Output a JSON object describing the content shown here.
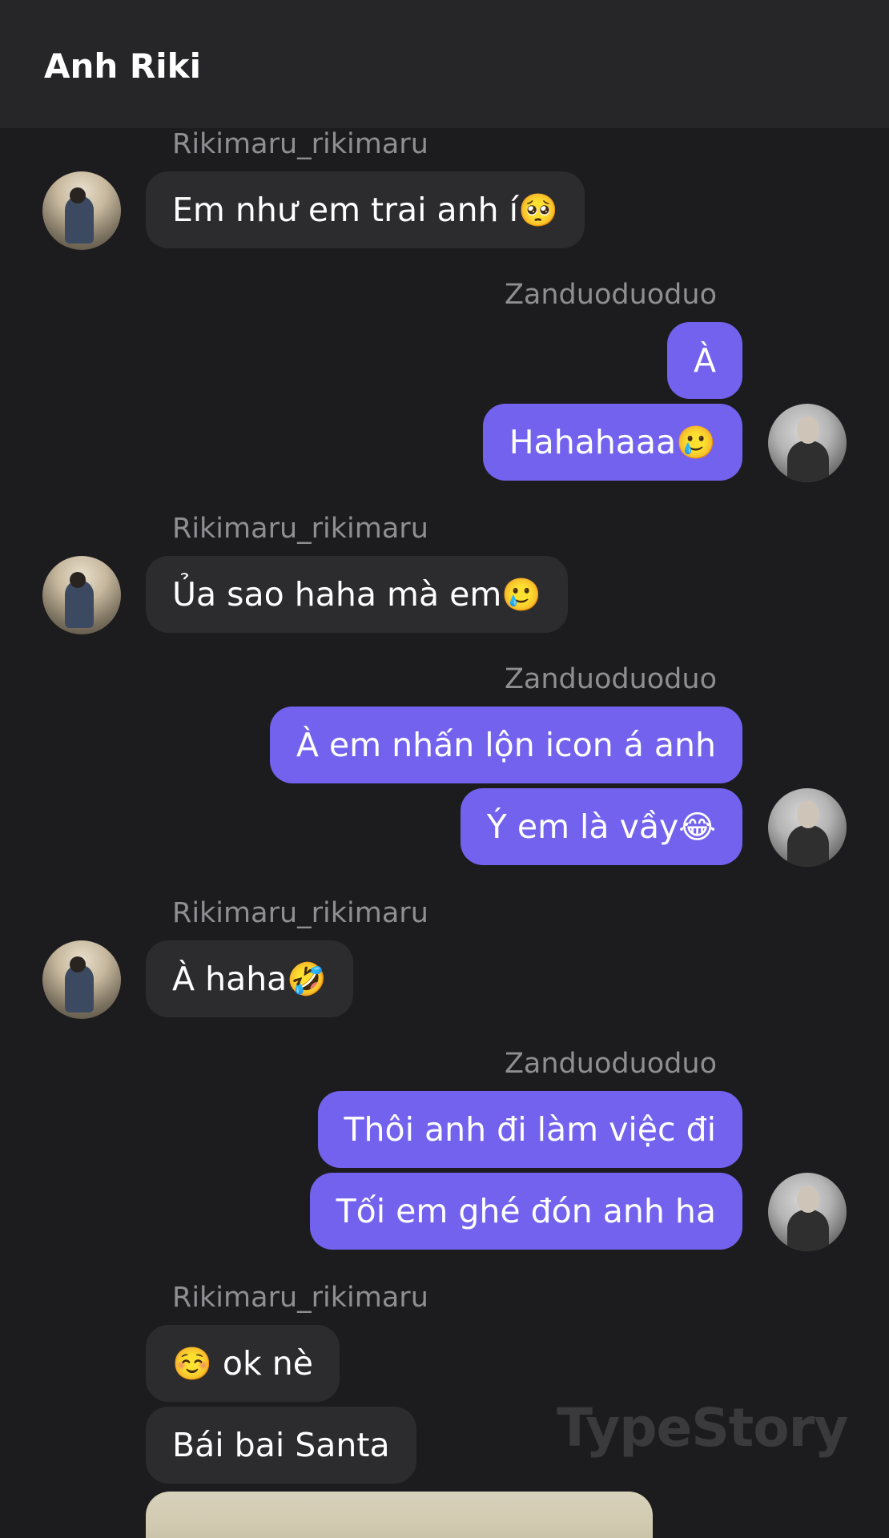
{
  "header": {
    "title": "Anh Riki"
  },
  "messages": [
    {
      "sender": "Rikimaru_rikimaru",
      "side": "in",
      "text": "Em như em trai anh í",
      "emoji": "🥺"
    },
    {
      "sender": "Zanduoduoduo",
      "side": "out",
      "text": "À"
    },
    {
      "side": "out",
      "text": "Hahahaaa",
      "emoji": "🥲"
    },
    {
      "sender": "Rikimaru_rikimaru",
      "side": "in",
      "text": "Ủa sao haha mà em",
      "emoji": "🥲"
    },
    {
      "sender": "Zanduoduoduo",
      "side": "out",
      "text": "À em nhấn lộn icon á anh"
    },
    {
      "side": "out",
      "text": "Ý em là vầy",
      "emoji": "😂"
    },
    {
      "sender": "Rikimaru_rikimaru",
      "side": "in",
      "text": "À haha",
      "emoji": "🤣"
    },
    {
      "sender": "Zanduoduoduo",
      "side": "out",
      "text": "Thôi anh đi làm việc đi"
    },
    {
      "side": "out",
      "text": "Tối em ghé đón anh ha"
    },
    {
      "sender": "Rikimaru_rikimaru",
      "side": "in",
      "emoji": "☺️",
      "text": "ok nè"
    },
    {
      "side": "in",
      "text": "Bái bai Santa"
    }
  ],
  "watermark": "TypeStory"
}
